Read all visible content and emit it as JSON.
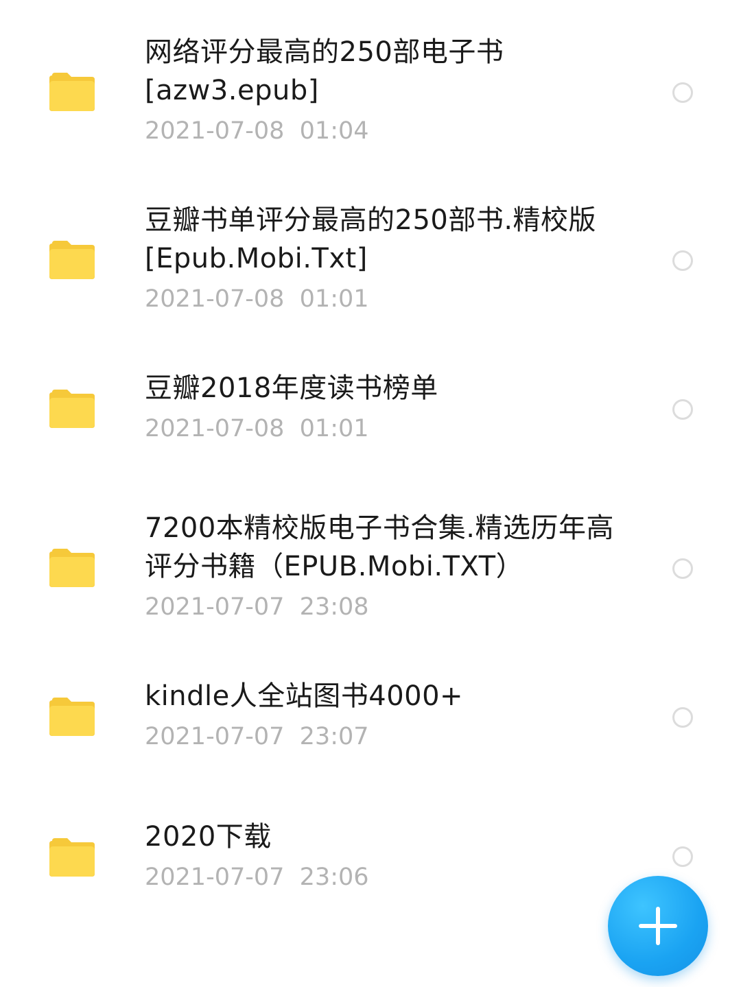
{
  "files": [
    {
      "name": "网络评分最高的250部电子书\n[azw3.epub]",
      "date": "2021-07-08  01:04"
    },
    {
      "name": "豆瓣书单评分最高的250部书.精校版\n[Epub.Mobi.Txt]",
      "date": "2021-07-08  01:01"
    },
    {
      "name": "豆瓣2018年度读书榜单",
      "date": "2021-07-08  01:01"
    },
    {
      "name": "7200本精校版电子书合集.精选历年高\n评分书籍（EPUB.Mobi.TXT）",
      "date": "2021-07-07  23:08"
    },
    {
      "name": "kindle人全站图书4000+",
      "date": "2021-07-07  23:07"
    },
    {
      "name": "2020下载",
      "date": "2021-07-07  23:06"
    }
  ],
  "icons": {
    "folder": "folder-icon",
    "select": "radio-circle-icon",
    "add": "plus-icon"
  },
  "colors": {
    "folder": "#FDD94F",
    "folder_tab": "#F6C93A",
    "fab": "#1AA3F2",
    "title_text": "#1A1A1A",
    "date_text": "#B3B3B3"
  }
}
